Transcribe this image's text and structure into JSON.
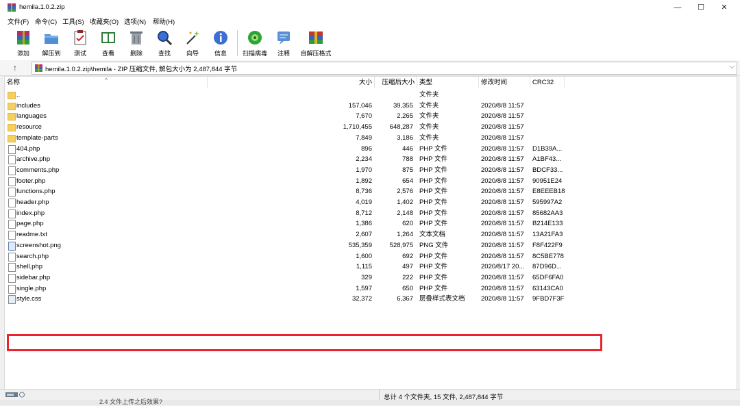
{
  "window": {
    "title": "hemila.1.0.2.zip",
    "controls": {
      "minimize": "—",
      "maximize": "☐",
      "close": "✕"
    }
  },
  "menu": [
    "文件(F)",
    "命令(C)",
    "工具(S)",
    "收藏夹(O)",
    "选项(N)",
    "帮助(H)"
  ],
  "toolbar": {
    "add": "添加",
    "extract": "解压到",
    "test": "测试",
    "view": "查看",
    "delete": "删除",
    "find": "查找",
    "wizard": "向导",
    "info": "信息",
    "scan": "扫描病毒",
    "comment": "注释",
    "sfx": "自解压格式"
  },
  "address": {
    "up": "↑",
    "path": "hemila.1.0.2.zip\\hemila - ZIP 压缩文件, 解包大小为 2,487,844 字节",
    "dropdown": "⌵"
  },
  "columns": {
    "name": "名称",
    "size": "大小",
    "packed": "压缩后大小",
    "type": "类型",
    "modified": "修改时间",
    "crc": "CRC32",
    "sort": "^"
  },
  "rows": [
    {
      "icon": "folder",
      "name": "..",
      "size": "",
      "packed": "",
      "type": "文件夹",
      "modified": "",
      "crc": ""
    },
    {
      "icon": "folder",
      "name": "includes",
      "size": "157,046",
      "packed": "39,355",
      "type": "文件夹",
      "modified": "2020/8/8 11:57",
      "crc": ""
    },
    {
      "icon": "folder",
      "name": "languages",
      "size": "7,670",
      "packed": "2,265",
      "type": "文件夹",
      "modified": "2020/8/8 11:57",
      "crc": ""
    },
    {
      "icon": "folder",
      "name": "resource",
      "size": "1,710,455",
      "packed": "648,287",
      "type": "文件夹",
      "modified": "2020/8/8 11:57",
      "crc": ""
    },
    {
      "icon": "folder",
      "name": "template-parts",
      "size": "7,849",
      "packed": "3,186",
      "type": "文件夹",
      "modified": "2020/8/8 11:57",
      "crc": ""
    },
    {
      "icon": "file",
      "name": "404.php",
      "size": "896",
      "packed": "446",
      "type": "PHP 文件",
      "modified": "2020/8/8 11:57",
      "crc": "D1B39A..."
    },
    {
      "icon": "file",
      "name": "archive.php",
      "size": "2,234",
      "packed": "788",
      "type": "PHP 文件",
      "modified": "2020/8/8 11:57",
      "crc": "A1BF43..."
    },
    {
      "icon": "file",
      "name": "comments.php",
      "size": "1,970",
      "packed": "875",
      "type": "PHP 文件",
      "modified": "2020/8/8 11:57",
      "crc": "BDCF33..."
    },
    {
      "icon": "file",
      "name": "footer.php",
      "size": "1,892",
      "packed": "654",
      "type": "PHP 文件",
      "modified": "2020/8/8 11:57",
      "crc": "90951E24"
    },
    {
      "icon": "file",
      "name": "functions.php",
      "size": "8,736",
      "packed": "2,576",
      "type": "PHP 文件",
      "modified": "2020/8/8 11:57",
      "crc": "E8EEEB18"
    },
    {
      "icon": "file",
      "name": "header.php",
      "size": "4,019",
      "packed": "1,402",
      "type": "PHP 文件",
      "modified": "2020/8/8 11:57",
      "crc": "595997A2"
    },
    {
      "icon": "file",
      "name": "index.php",
      "size": "8,712",
      "packed": "2,148",
      "type": "PHP 文件",
      "modified": "2020/8/8 11:57",
      "crc": "85682AA3"
    },
    {
      "icon": "file",
      "name": "page.php",
      "size": "1,386",
      "packed": "620",
      "type": "PHP 文件",
      "modified": "2020/8/8 11:57",
      "crc": "B214E133"
    },
    {
      "icon": "txt",
      "name": "readme.txt",
      "size": "2,607",
      "packed": "1,264",
      "type": "文本文档",
      "modified": "2020/8/8 11:57",
      "crc": "13A21FA3"
    },
    {
      "icon": "png",
      "name": "screenshot.png",
      "size": "535,359",
      "packed": "528,975",
      "type": "PNG 文件",
      "modified": "2020/8/8 11:57",
      "crc": "F8F422F9"
    },
    {
      "icon": "file",
      "name": "search.php",
      "size": "1,600",
      "packed": "692",
      "type": "PHP 文件",
      "modified": "2020/8/8 11:57",
      "crc": "8C5BE778"
    },
    {
      "icon": "file",
      "name": "shell.php",
      "size": "1,115",
      "packed": "497",
      "type": "PHP 文件",
      "modified": "2020/8/17 20...",
      "crc": "87D96D..."
    },
    {
      "icon": "file",
      "name": "sidebar.php",
      "size": "329",
      "packed": "222",
      "type": "PHP 文件",
      "modified": "2020/8/8 11:57",
      "crc": "65DF6FA0"
    },
    {
      "icon": "file",
      "name": "single.php",
      "size": "1,597",
      "packed": "650",
      "type": "PHP 文件",
      "modified": "2020/8/8 11:57",
      "crc": "63143CA0"
    },
    {
      "icon": "css",
      "name": "style.css",
      "size": "32,372",
      "packed": "6,367",
      "type": "层叠样式表文档",
      "modified": "2020/8/8 11:57",
      "crc": "9FBD7F3F"
    }
  ],
  "highlighted_row": "shell.php",
  "highlight_color": "#e8252e",
  "status": {
    "summary": "总计 4 个文件夹, 15 文件, 2,487,844 字节"
  },
  "below_window_text": "2.4 文件上传之后效果?"
}
